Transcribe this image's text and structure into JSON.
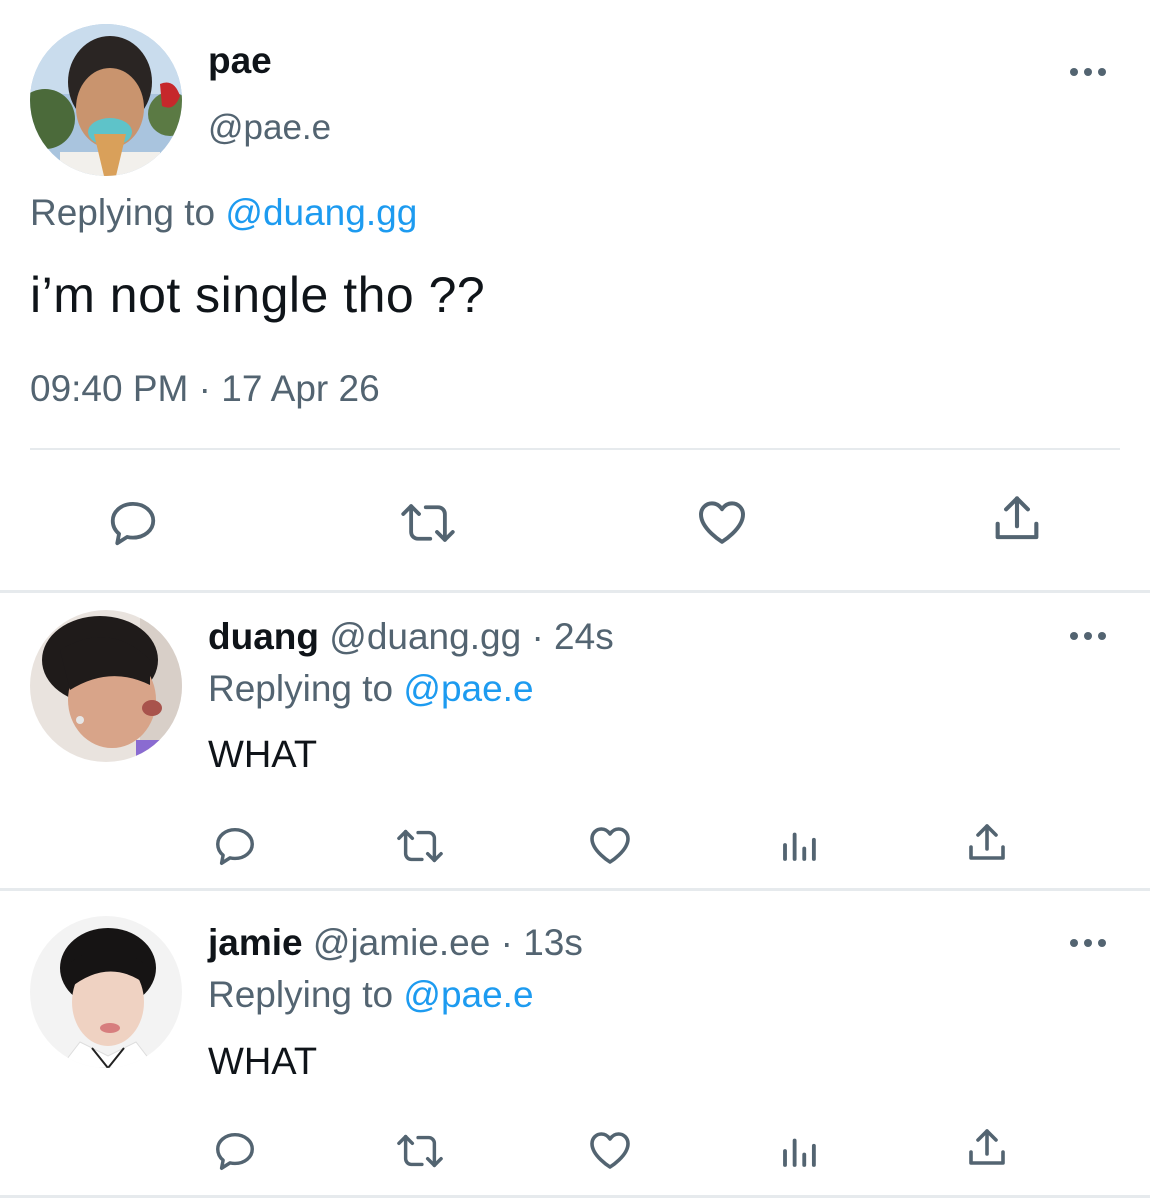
{
  "main_tweet": {
    "display_name": "pae",
    "handle": "@pae.e",
    "replying_label": "Replying to",
    "replying_to": "@duang.gg",
    "text": "i’m not single tho ??",
    "timestamp": "09:40 PM · 17 Apr 26"
  },
  "actions_main": [
    "reply-icon",
    "retweet-icon",
    "like-icon",
    "share-icon"
  ],
  "replies": [
    {
      "display_name": "duang",
      "handle": "@duang.gg",
      "time": "· 24s",
      "replying_label": "Replying to",
      "replying_to": "@pae.e",
      "text": "WHAT"
    },
    {
      "display_name": "jamie",
      "handle": "@jamie.ee",
      "time": "· 13s",
      "replying_label": "Replying to",
      "replying_to": "@pae.e",
      "text": "WHAT"
    }
  ],
  "actions_reply": [
    "reply-icon",
    "retweet-icon",
    "like-icon",
    "analytics-icon",
    "share-icon"
  ],
  "colors": {
    "link": "#1d9bf0",
    "secondary_text": "#536471",
    "primary_text": "#0f1419",
    "divider": "#e6eaed"
  }
}
